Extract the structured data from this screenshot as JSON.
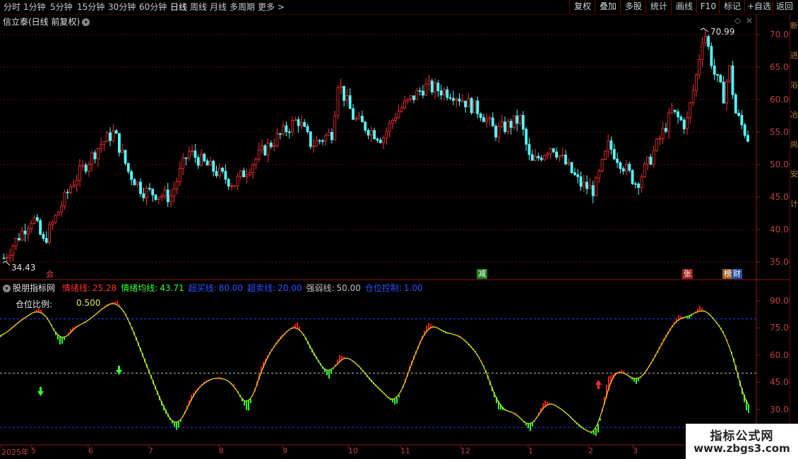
{
  "toolbar": {
    "periods": [
      "分时",
      "1分钟",
      "5分钟",
      "15分钟",
      "30分钟",
      "60分钟",
      "日线",
      "周线",
      "月线",
      "多周期",
      "更多 >"
    ],
    "active_period": "日线",
    "buttons": [
      "复权",
      "叠加",
      "多股",
      "统计",
      "画线",
      "F10",
      "标记",
      "+自选",
      "返回"
    ]
  },
  "main_panel": {
    "title": "信立泰(日线 前复权)",
    "high_label": "70.99",
    "low_label": "34.43",
    "price_ticks": [
      "70.00",
      "65.00",
      "60.00",
      "55.00",
      "50.00",
      "45.00",
      "40.00",
      "35.00"
    ],
    "markers": {
      "left": "会",
      "cut": "减",
      "rise": "张",
      "rank": "榜",
      "rank2": "财"
    }
  },
  "indicator_panel": {
    "title": "股朋指标网",
    "lines": [
      {
        "label": "情绪线:",
        "value": "25.28",
        "color": "#ff3030"
      },
      {
        "label": "情绪均线:",
        "value": "43.71",
        "color": "#30ff30"
      },
      {
        "label": "超买线:",
        "value": "80.00",
        "color": "#3050ff"
      },
      {
        "label": "超卖线:",
        "value": "20.00",
        "color": "#3050ff"
      },
      {
        "label": "强弱线:",
        "value": "50.00",
        "color": "#c0c0c0"
      },
      {
        "label": "仓位控制:",
        "value": "1.00",
        "color": "#3050ff"
      }
    ],
    "position_label": "仓位比例:",
    "position_value": "0.500",
    "ticks": [
      "90.00",
      "75.00",
      "60.00",
      "45.00",
      "30.00"
    ]
  },
  "dates": [
    "2025年",
    "5",
    "6",
    "7",
    "8",
    "9",
    "10",
    "11",
    "12",
    "1",
    "2",
    "3"
  ],
  "sidebar_chars": [
    "新",
    "进",
    "浴",
    "冶",
    "尚",
    "安",
    "计"
  ],
  "watermark": {
    "title": "指标公式网",
    "url": "www.zbgs3.com"
  },
  "colors": {
    "up": "#ff3030",
    "down": "#54ffff",
    "green": "#30ff30",
    "axis": "#c04040",
    "grid": "#5a1010"
  }
}
